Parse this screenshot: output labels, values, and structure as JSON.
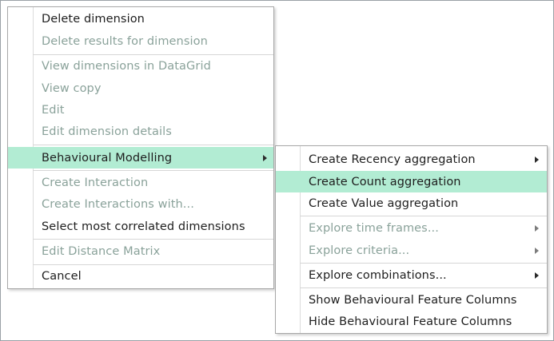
{
  "context_menu": {
    "items": [
      {
        "label": "Delete dimension",
        "enabled": true
      },
      {
        "label": "Delete results for dimension",
        "enabled": false
      },
      {
        "label": "View dimensions in DataGrid",
        "enabled": false
      },
      {
        "label": "View copy",
        "enabled": false
      },
      {
        "label": "Edit",
        "enabled": false
      },
      {
        "label": "Edit dimension details",
        "enabled": false
      },
      {
        "label": "Behavioural Modelling",
        "enabled": true,
        "highlighted": true,
        "submenu": true
      },
      {
        "label": "Create Interaction",
        "enabled": false
      },
      {
        "label": "Create Interactions with...",
        "enabled": false
      },
      {
        "label": "Select most correlated dimensions",
        "enabled": true
      },
      {
        "label": "Edit Distance Matrix",
        "enabled": false
      },
      {
        "label": "Cancel",
        "enabled": true
      }
    ]
  },
  "submenu": {
    "items": [
      {
        "label": "Create Recency aggregation",
        "enabled": true,
        "submenu": true
      },
      {
        "label": "Create Count aggregation",
        "enabled": true,
        "highlighted": true
      },
      {
        "label": "Create Value aggregation",
        "enabled": true
      },
      {
        "label": "Explore time frames...",
        "enabled": false,
        "submenu": true
      },
      {
        "label": "Explore criteria...",
        "enabled": false,
        "submenu": true
      },
      {
        "label": "Explore combinations...",
        "enabled": true,
        "submenu": true
      },
      {
        "label": "Show Behavioural Feature Columns",
        "enabled": true
      },
      {
        "label": "Hide Behavioural Feature Columns",
        "enabled": true
      }
    ]
  },
  "colors": {
    "highlight": "#b2ecd3",
    "enabled_text": "#1e1e1e",
    "disabled_text": "#8aa29a"
  },
  "icons": {
    "submenu_indicator": "chevron-right-icon"
  }
}
